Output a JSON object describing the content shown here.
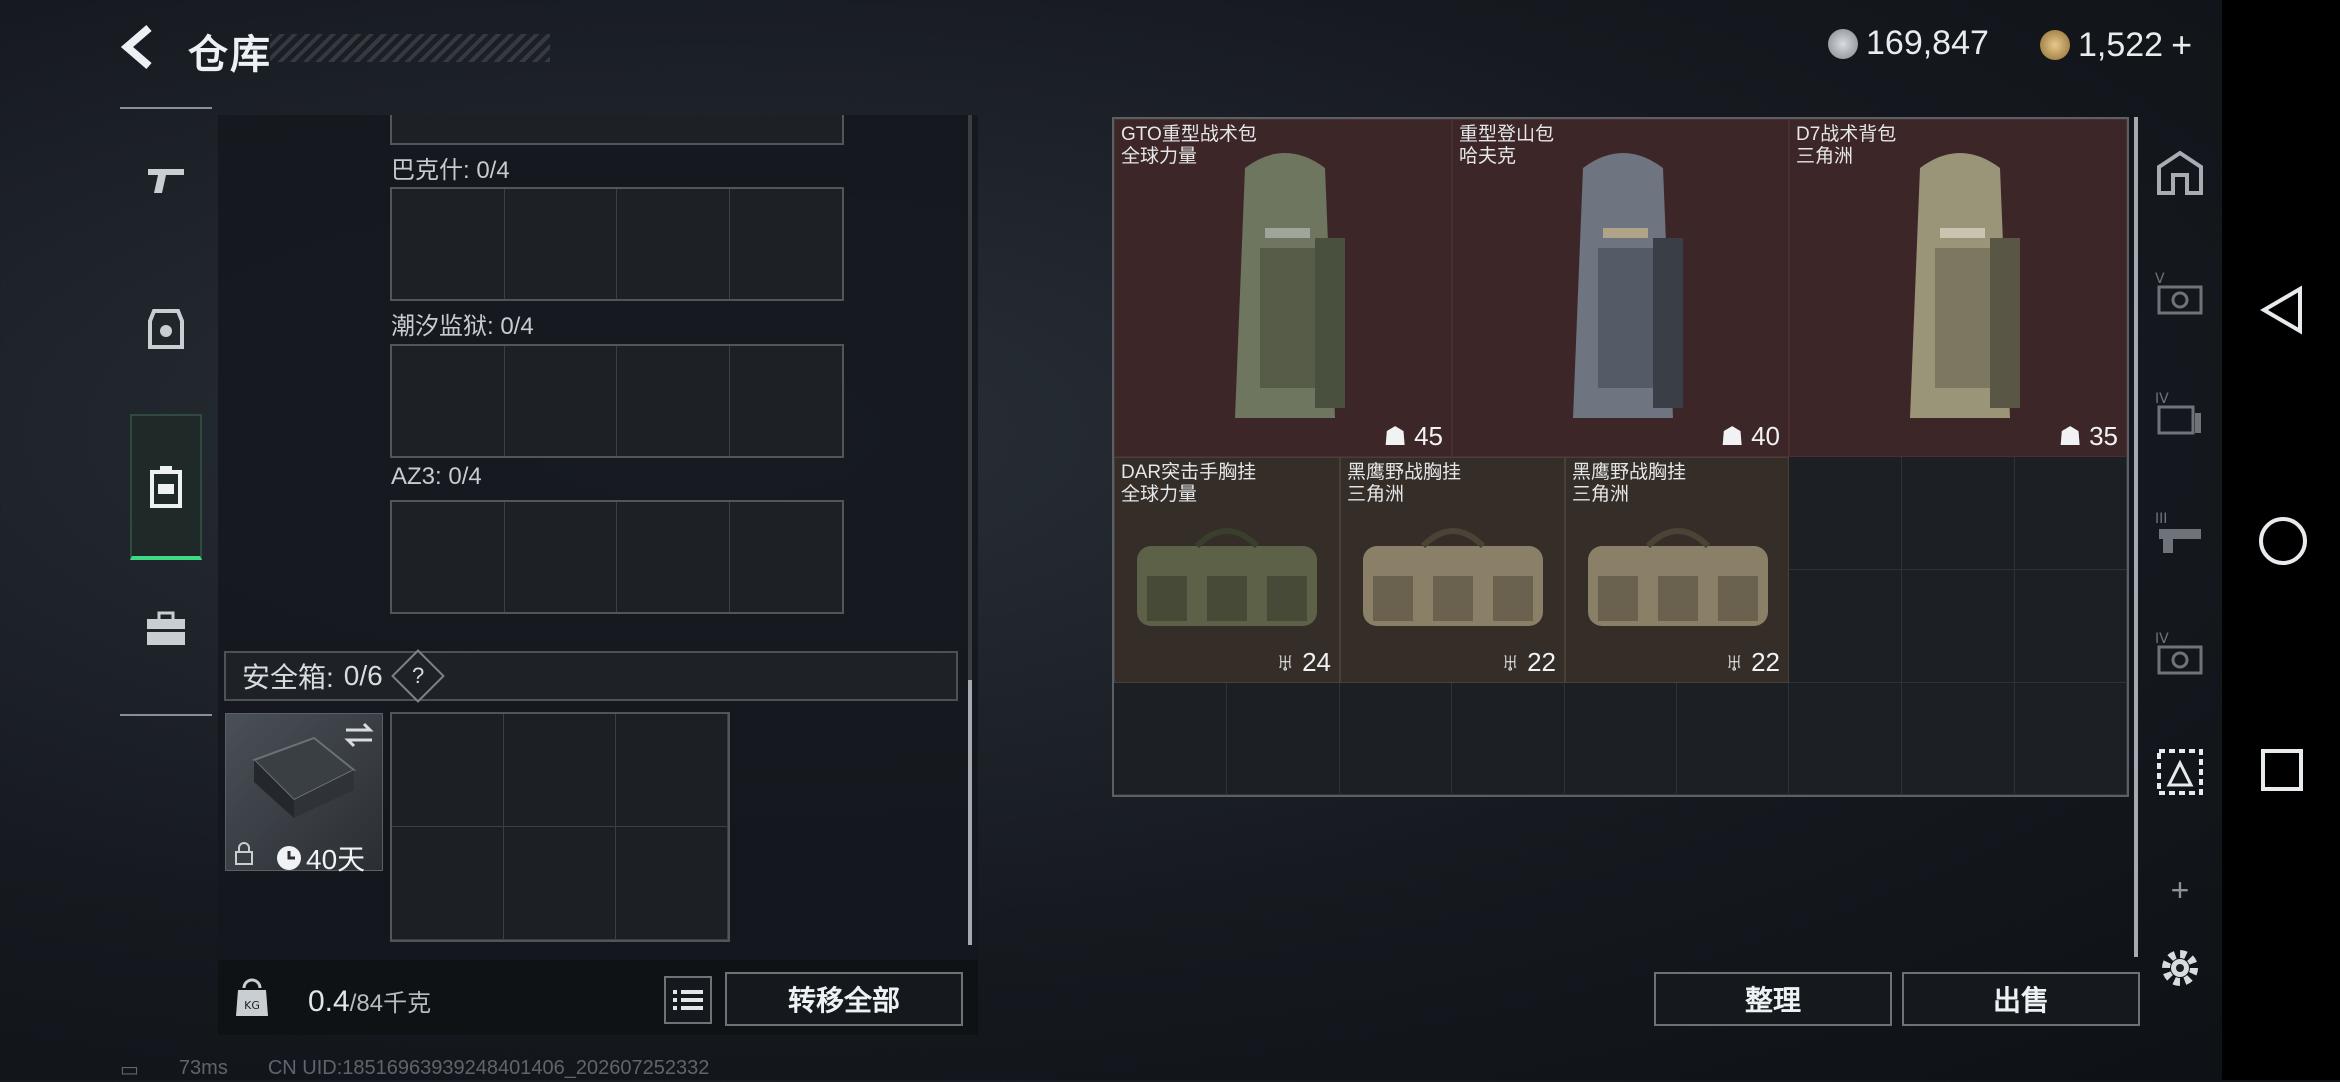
{
  "header": {
    "title": "仓库",
    "currency1": "169,847",
    "currency2": "1,522",
    "plus": "+"
  },
  "left_nav": [
    "gun-icon",
    "armor-icon",
    "backpack-icon",
    "briefcase-icon"
  ],
  "slots": [
    {
      "label": "巴克什: 0/4"
    },
    {
      "label": "潮汐监狱: 0/4"
    },
    {
      "label": "AZ3: 0/4"
    }
  ],
  "safe": {
    "label": "安全箱:",
    "count": "0/6",
    "help": "?",
    "days": "40天"
  },
  "bottom": {
    "weight_value": "0.4",
    "weight_total": "/84千克",
    "transfer_all": "转移全部",
    "sort": "整理",
    "sell": "出售"
  },
  "items": [
    {
      "name1": "GTO重型战术包",
      "name2": "全球力量",
      "cap": "45"
    },
    {
      "name1": "重型登山包",
      "name2": "哈夫克",
      "cap": "40"
    },
    {
      "name1": "D7战术背包",
      "name2": "三角洲",
      "cap": "35"
    },
    {
      "name1": "DAR突击手胸挂",
      "name2": "全球力量",
      "cap": "24"
    },
    {
      "name1": "黑鹰野战胸挂",
      "name2": "三角洲",
      "cap": "22"
    },
    {
      "name1": "黑鹰野战胸挂",
      "name2": "三角洲",
      "cap": "22"
    }
  ],
  "right_nav_labels": [
    "",
    "V",
    "IV",
    "III",
    "IV",
    "",
    "+"
  ],
  "status": {
    "ping": "73ms",
    "uid": "CN UID:185169639392484014​06_202607252332"
  },
  "colors": {
    "accent_green": "#3ddc84",
    "item_red": "#3d2628",
    "item_brown": "#352d27"
  }
}
